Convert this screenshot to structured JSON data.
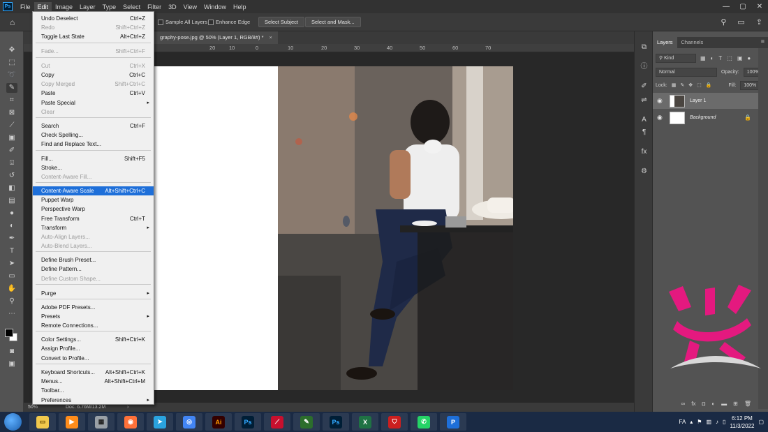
{
  "app": {
    "logo_text": "Ps",
    "menus": [
      "File",
      "Edit",
      "Image",
      "Layer",
      "Type",
      "Select",
      "Filter",
      "3D",
      "View",
      "Window",
      "Help"
    ],
    "active_menu": "Edit",
    "window_controls": [
      "—",
      "▢",
      "✕"
    ]
  },
  "options_bar": {
    "sample_all_layers": "Sample All Layers",
    "enhance_edge": "Enhance Edge",
    "select_subject": "Select Subject",
    "select_and_mask": "Select and Mask..."
  },
  "document": {
    "tab_title": "graphy-pose.jpg @ 50% (Layer 1, RGB/8#) *",
    "ruler_ticks": [
      "20",
      "10",
      "0",
      "10",
      "20",
      "30",
      "40",
      "50",
      "60",
      "70"
    ],
    "zoom": "50%",
    "doc_size": "Doc: 6.76M/13.2M"
  },
  "edit_menu": {
    "items": [
      {
        "label": "Undo Deselect",
        "shortcut": "Ctrl+Z",
        "disabled": false
      },
      {
        "label": "Redo",
        "shortcut": "Shift+Ctrl+Z",
        "disabled": true
      },
      {
        "label": "Toggle Last State",
        "shortcut": "Alt+Ctrl+Z",
        "disabled": false
      },
      {
        "label": "Fade...",
        "shortcut": "Shift+Ctrl+F",
        "disabled": true
      },
      {
        "label": "Cut",
        "shortcut": "Ctrl+X",
        "disabled": true
      },
      {
        "label": "Copy",
        "shortcut": "Ctrl+C",
        "disabled": false
      },
      {
        "label": "Copy Merged",
        "shortcut": "Shift+Ctrl+C",
        "disabled": true
      },
      {
        "label": "Paste",
        "shortcut": "Ctrl+V",
        "disabled": false
      },
      {
        "label": "Paste Special",
        "shortcut": "",
        "submenu": true,
        "disabled": false
      },
      {
        "label": "Clear",
        "shortcut": "",
        "disabled": true
      },
      {
        "label": "Search",
        "shortcut": "Ctrl+F",
        "disabled": false
      },
      {
        "label": "Check Spelling...",
        "shortcut": "",
        "disabled": false
      },
      {
        "label": "Find and Replace Text...",
        "shortcut": "",
        "disabled": false
      },
      {
        "label": "Fill...",
        "shortcut": "Shift+F5",
        "disabled": false
      },
      {
        "label": "Stroke...",
        "shortcut": "",
        "disabled": false
      },
      {
        "label": "Content-Aware Fill...",
        "shortcut": "",
        "disabled": true
      },
      {
        "label": "Content-Aware Scale",
        "shortcut": "Alt+Shift+Ctrl+C",
        "disabled": false,
        "highlighted": true
      },
      {
        "label": "Puppet Warp",
        "shortcut": "",
        "disabled": false
      },
      {
        "label": "Perspective Warp",
        "shortcut": "",
        "disabled": false
      },
      {
        "label": "Free Transform",
        "shortcut": "Ctrl+T",
        "disabled": false
      },
      {
        "label": "Transform",
        "shortcut": "",
        "submenu": true,
        "disabled": false
      },
      {
        "label": "Auto-Align Layers...",
        "shortcut": "",
        "disabled": true
      },
      {
        "label": "Auto-Blend Layers...",
        "shortcut": "",
        "disabled": true
      },
      {
        "label": "Define Brush Preset...",
        "shortcut": "",
        "disabled": false
      },
      {
        "label": "Define Pattern...",
        "shortcut": "",
        "disabled": false
      },
      {
        "label": "Define Custom Shape...",
        "shortcut": "",
        "disabled": true
      },
      {
        "label": "Purge",
        "shortcut": "",
        "submenu": true,
        "disabled": false
      },
      {
        "label": "Adobe PDF Presets...",
        "shortcut": "",
        "disabled": false
      },
      {
        "label": "Presets",
        "shortcut": "",
        "submenu": true,
        "disabled": false
      },
      {
        "label": "Remote Connections...",
        "shortcut": "",
        "disabled": false
      },
      {
        "label": "Color Settings...",
        "shortcut": "Shift+Ctrl+K",
        "disabled": false
      },
      {
        "label": "Assign Profile...",
        "shortcut": "",
        "disabled": false
      },
      {
        "label": "Convert to Profile...",
        "shortcut": "",
        "disabled": false
      },
      {
        "label": "Keyboard Shortcuts...",
        "shortcut": "Alt+Shift+Ctrl+K",
        "disabled": false
      },
      {
        "label": "Menus...",
        "shortcut": "Alt+Shift+Ctrl+M",
        "disabled": false
      },
      {
        "label": "Toolbar...",
        "shortcut": "",
        "disabled": false
      },
      {
        "label": "Preferences",
        "shortcut": "",
        "submenu": true,
        "disabled": false
      }
    ]
  },
  "layers_panel": {
    "tabs": [
      "Layers",
      "Channels"
    ],
    "kind_label": "Kind",
    "blend_mode": "Normal",
    "opacity_label": "Opacity:",
    "opacity_value": "100%",
    "lock_label": "Lock:",
    "fill_label": "Fill:",
    "fill_value": "100%",
    "layers": [
      {
        "name": "Layer 1",
        "selected": true
      },
      {
        "name": "Background",
        "selected": false,
        "locked": true
      }
    ]
  },
  "taskbar": {
    "apps": [
      "File Explorer",
      "Media Player",
      "Calculator",
      "Firefox",
      "Telegram",
      "Chrome",
      "Illustrator",
      "Photoshop",
      "Acrobat",
      "Tool",
      "Photoshop",
      "Excel",
      "Antivirus",
      "WhatsApp",
      "Publisher"
    ],
    "app_glyphs": [
      "▭",
      "▶",
      "▦",
      "◉",
      "➤",
      "◎",
      "Ai",
      "Ps",
      "⟋",
      "✎",
      "Ps",
      "X",
      "⛉",
      "✆",
      "P"
    ],
    "language": "FA",
    "time": "6:12 PM",
    "date": "11/3/2022"
  },
  "colors": {
    "menu_highlight": "#1e6fd9",
    "panel_bg": "#535353",
    "watermark": "#e4197f"
  }
}
